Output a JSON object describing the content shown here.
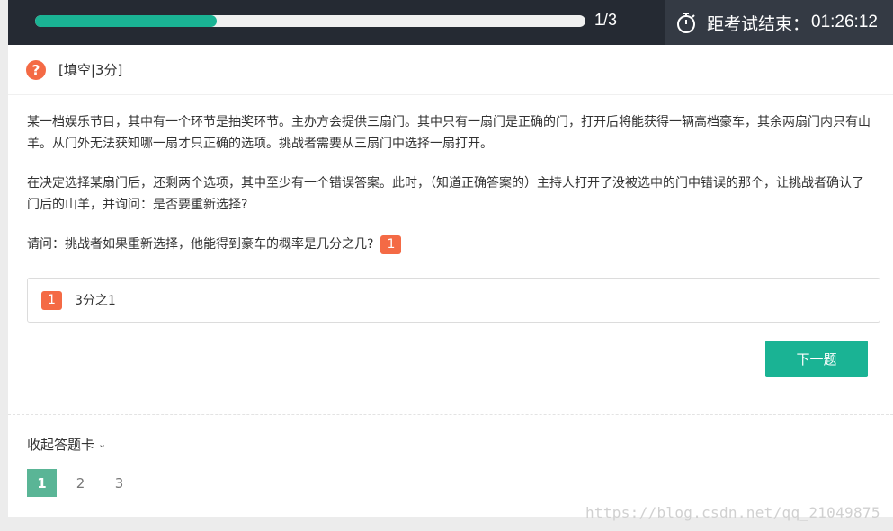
{
  "topbar": {
    "progress": 0.33,
    "progress_text": "1/3",
    "timer_label": "距考试结束：",
    "timer_value": "01:26:12"
  },
  "question": {
    "type_label": "[填空|3分]",
    "paragraphs": [
      "某一档娱乐节目，其中有一个环节是抽奖环节。主办方会提供三扇门。其中只有一扇门是正确的门，打开后将能获得一辆高档豪车，其余两扇门内只有山羊。从门外无法获知哪一扇才只正确的选项。挑战者需要从三扇门中选择一扇打开。",
      "在决定选择某扇门后，还剩两个选项，其中至少有一个错误答案。此时，（知道正确答案的）主持人打开了没被选中的门中错误的那个，让挑战者确认了门后的山羊，并询问：是否要重新选择?"
    ],
    "prompt": "请问：挑战者如果重新选择，他能得到豪车的概率是几分之几?",
    "blank_number": "1"
  },
  "answer": {
    "number": "1",
    "value": "3分之1"
  },
  "next_button": "下一题",
  "answer_card": {
    "toggle_label": "收起答题卡",
    "numbers": [
      "1",
      "2",
      "3"
    ],
    "active_index": 0
  },
  "watermark": "https://blog.csdn.net/qq_21049875",
  "colors": {
    "accent": "#1ab394",
    "badge": "#f46a45",
    "topbar": "#252a33"
  }
}
